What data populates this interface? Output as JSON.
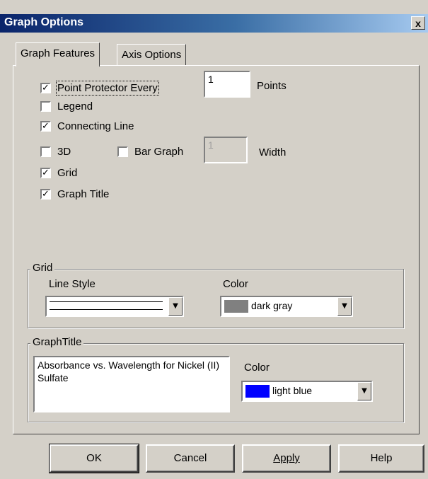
{
  "window": {
    "title": "Graph Options",
    "close_glyph": "x"
  },
  "tabs": [
    {
      "label": "Graph Features"
    },
    {
      "label": "Axis Options"
    }
  ],
  "features": {
    "point_protector": {
      "checked_mark": "✓",
      "label": "Point Protector Every",
      "value": "1",
      "unit": "Points"
    },
    "legend": {
      "checked_mark": "",
      "label": "Legend"
    },
    "connecting_line": {
      "checked_mark": "✓",
      "label": "Connecting Line"
    },
    "three_d": {
      "checked_mark": "",
      "label": "3D"
    },
    "bar_graph": {
      "checked_mark": "",
      "label": "Bar Graph",
      "value": "1",
      "unit": "Width"
    },
    "grid": {
      "checked_mark": "✓",
      "label": "Grid"
    },
    "graph_title": {
      "checked_mark": "✓",
      "label": "Graph Title"
    }
  },
  "grid_group": {
    "title": "Grid",
    "line_style_label": "Line Style",
    "color_label": "Color",
    "color_value": "dark gray",
    "color_swatch": "#808080"
  },
  "title_group": {
    "title": "GraphTitle",
    "text": "Absorbance vs. Wavelength for Nickel (II) Sulfate",
    "color_label": "Color",
    "color_value": "light blue",
    "color_swatch": "#0000ff"
  },
  "buttons": {
    "ok": "OK",
    "cancel": "Cancel",
    "apply": "Apply",
    "help": "Help"
  },
  "icons": {
    "dropdown": "▼"
  }
}
